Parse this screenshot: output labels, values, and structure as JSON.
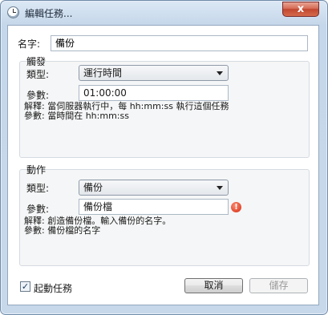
{
  "window": {
    "title": "編輯任務...",
    "close_glyph": "x"
  },
  "name": {
    "label": "名字:",
    "value": "備份"
  },
  "schedule": {
    "legend": "觸發",
    "type_label": "類型:",
    "type_value": "運行時間",
    "param_label": "參數:",
    "param_value": "01:00:00",
    "desc_line1": "解釋: 當伺服器執行中，每 hh:mm:ss 執行這個任務",
    "desc_line2": "參數: 當時間在 hh:mm:ss"
  },
  "action": {
    "legend": "動作",
    "type_label": "類型:",
    "type_value": "備份",
    "param_label": "參數:",
    "param_value": "備份檔",
    "warning_glyph": "!",
    "desc_line1": "解釋: 創造備份檔。輸入備份的名字。",
    "desc_line2": "參數: 備份檔的名字"
  },
  "footer": {
    "checkbox_checked": true,
    "checkbox_glyph": "✓",
    "checkbox_label": "起動任務",
    "cancel_label": "取消",
    "save_label": "儲存"
  }
}
